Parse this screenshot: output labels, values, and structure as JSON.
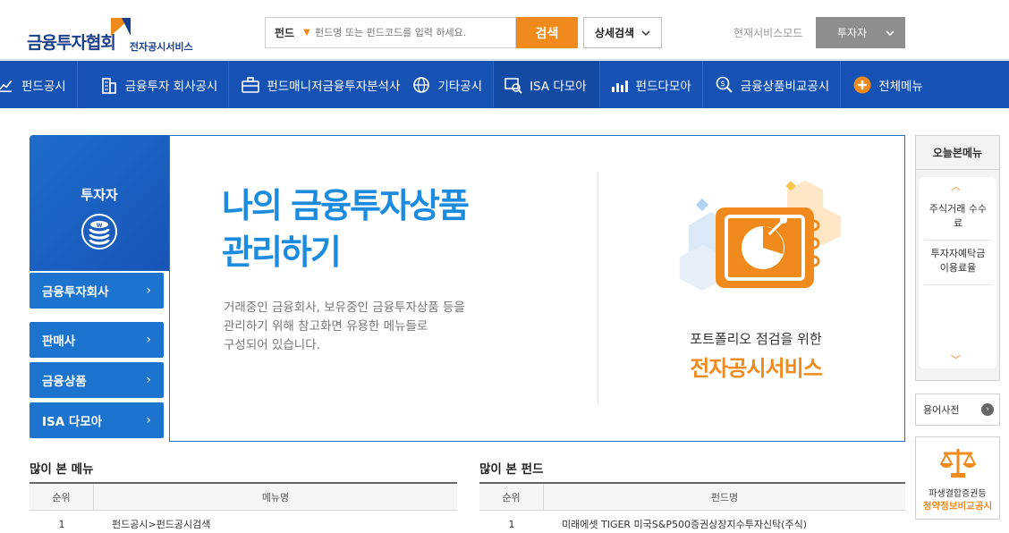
{
  "header": {
    "logo_main": "금융투자협회",
    "logo_sub": "전자공시서비스",
    "search_category": "펀드",
    "search_placeholder": "펀드명 또는 펀드코드를 입력 하세요.",
    "search_button": "검색",
    "detail_search": "상세검색",
    "mode_label": "현재서비스모드",
    "mode_value": "투자자"
  },
  "nav": {
    "items": [
      {
        "label": "펀드공시",
        "icon": "chart-icon"
      },
      {
        "label": "금융투자 회사공시",
        "icon": "building-icon"
      },
      {
        "label": "펀드매니저금융투자분석사",
        "icon": "briefcase-icon"
      },
      {
        "label": "기타공시",
        "icon": "globe-icon"
      },
      {
        "label": "ISA 다모아",
        "icon": "isa-icon"
      },
      {
        "label": "펀드다모아",
        "icon": "bar-icon"
      },
      {
        "label": "금융상품비교공시",
        "icon": "coin-search-icon"
      },
      {
        "label": "전체메뉴",
        "icon": "plus-circle-icon"
      }
    ]
  },
  "left_panel": {
    "title": "투자자",
    "buttons": [
      "금융투자회사",
      "판매사",
      "금융상품",
      "ISA 다모아"
    ]
  },
  "banner": {
    "title_line1": "나의 금융투자상품",
    "title_line2": "관리하기",
    "desc_line1": "거래중인 금융회사, 보유중인 금융투자상품 등을",
    "desc_line2": "관리하기 위해 참고화면 유용한 메뉴들로",
    "desc_line3": "구성되어 있습니다.",
    "sub_line1": "포트폴리오 점검을 위한",
    "sub_line2": "전자공시서비스"
  },
  "right_panel": {
    "today_title": "오늘본메뉴",
    "items": [
      {
        "line1": "주식거래 수수",
        "line2": "료"
      },
      {
        "line1": "투자자예탁금",
        "line2": "이용료율"
      }
    ],
    "dict_label": "용어사전",
    "compare_line1": "파생결합증권등",
    "compare_line2": "청약정보비교공시"
  },
  "most_viewed_menu": {
    "title": "많이 본 메뉴",
    "col_rank": "순위",
    "col_name": "메뉴명",
    "rows": [
      {
        "rank": "1",
        "name": "펀드공시>펀드공시검색"
      }
    ]
  },
  "most_viewed_fund": {
    "title": "많이 본 펀드",
    "col_rank": "순위",
    "col_name": "펀드명",
    "rows": [
      {
        "rank": "1",
        "name": "미래에셋 TIGER 미국S&P500증권상장지수투자신탁(주식)"
      }
    ]
  },
  "colors": {
    "nav_bg": "#1652b4",
    "accent_orange": "#f08a1c",
    "accent_blue": "#1b8be0"
  }
}
